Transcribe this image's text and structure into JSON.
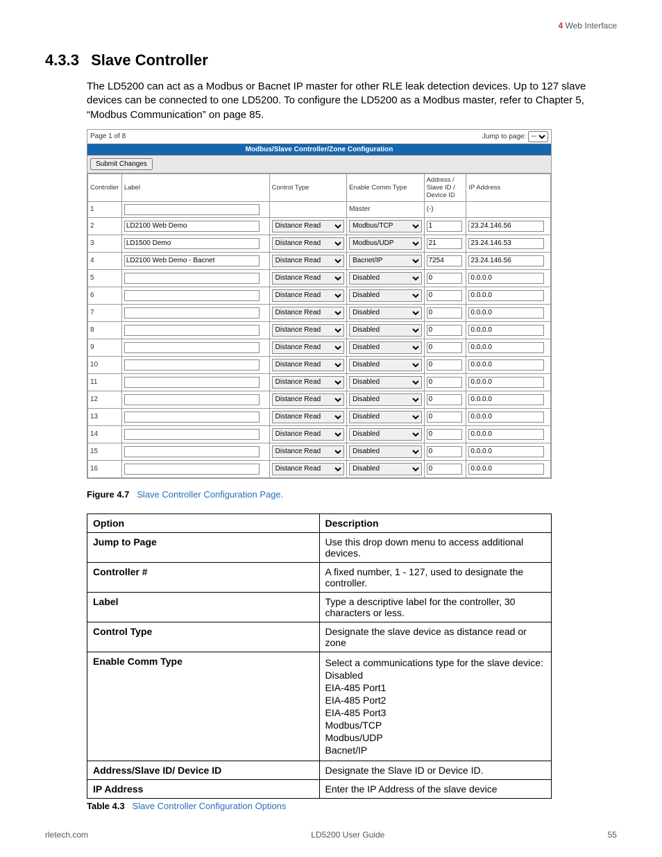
{
  "header": {
    "chapter_num": "4",
    "chapter_title": "Web Interface"
  },
  "section": {
    "number": "4.3.3",
    "title": "Slave Controller"
  },
  "body_paragraph": "The LD5200 can act as a Modbus or Bacnet IP master for other RLE leak detection devices. Up to 127 slave devices can be connected to one LD5200. To configure the LD5200 as a Modbus master, refer to Chapter 5, “Modbus Communication” on page 85.",
  "screenshot": {
    "page_indicator": "Page 1 of 8",
    "jump_label": "Jump to page:",
    "jump_value": "--",
    "title": "Modbus/Slave Controller/Zone Configuration",
    "submit_label": "Submit Changes",
    "columns": {
      "controller": "Controller",
      "label": "Label",
      "control_type": "Control Type",
      "enable_comm": "Enable Comm Type",
      "address": "Address / Slave ID / Device ID",
      "ip": "IP Address"
    },
    "rows": [
      {
        "n": "1",
        "label": "",
        "ctype": "",
        "ctype_select": false,
        "comm": "Master",
        "comm_select": false,
        "addr": "(-)",
        "addr_input": false,
        "ip": "",
        "ip_input": false
      },
      {
        "n": "2",
        "label": "LD2100 Web Demo",
        "ctype": "Distance Read",
        "ctype_select": true,
        "comm": "Modbus/TCP",
        "comm_select": true,
        "addr": "1",
        "addr_input": true,
        "ip": "23.24.146.56",
        "ip_input": true
      },
      {
        "n": "3",
        "label": "LD1500 Demo",
        "ctype": "Distance Read",
        "ctype_select": true,
        "comm": "Modbus/UDP",
        "comm_select": true,
        "addr": "21",
        "addr_input": true,
        "ip": "23.24.146.53",
        "ip_input": true
      },
      {
        "n": "4",
        "label": "LD2100 Web Demo - Bacnet",
        "ctype": "Distance Read",
        "ctype_select": true,
        "comm": "Bacnet/IP",
        "comm_select": true,
        "addr": "7254",
        "addr_input": true,
        "ip": "23.24.146.56",
        "ip_input": true
      },
      {
        "n": "5",
        "label": "",
        "ctype": "Distance Read",
        "ctype_select": true,
        "comm": "Disabled",
        "comm_select": true,
        "addr": "0",
        "addr_input": true,
        "ip": "0.0.0.0",
        "ip_input": true
      },
      {
        "n": "6",
        "label": "",
        "ctype": "Distance Read",
        "ctype_select": true,
        "comm": "Disabled",
        "comm_select": true,
        "addr": "0",
        "addr_input": true,
        "ip": "0.0.0.0",
        "ip_input": true
      },
      {
        "n": "7",
        "label": "",
        "ctype": "Distance Read",
        "ctype_select": true,
        "comm": "Disabled",
        "comm_select": true,
        "addr": "0",
        "addr_input": true,
        "ip": "0.0.0.0",
        "ip_input": true
      },
      {
        "n": "8",
        "label": "",
        "ctype": "Distance Read",
        "ctype_select": true,
        "comm": "Disabled",
        "comm_select": true,
        "addr": "0",
        "addr_input": true,
        "ip": "0.0.0.0",
        "ip_input": true
      },
      {
        "n": "9",
        "label": "",
        "ctype": "Distance Read",
        "ctype_select": true,
        "comm": "Disabled",
        "comm_select": true,
        "addr": "0",
        "addr_input": true,
        "ip": "0.0.0.0",
        "ip_input": true
      },
      {
        "n": "10",
        "label": "",
        "ctype": "Distance Read",
        "ctype_select": true,
        "comm": "Disabled",
        "comm_select": true,
        "addr": "0",
        "addr_input": true,
        "ip": "0.0.0.0",
        "ip_input": true
      },
      {
        "n": "11",
        "label": "",
        "ctype": "Distance Read",
        "ctype_select": true,
        "comm": "Disabled",
        "comm_select": true,
        "addr": "0",
        "addr_input": true,
        "ip": "0.0.0.0",
        "ip_input": true
      },
      {
        "n": "12",
        "label": "",
        "ctype": "Distance Read",
        "ctype_select": true,
        "comm": "Disabled",
        "comm_select": true,
        "addr": "0",
        "addr_input": true,
        "ip": "0.0.0.0",
        "ip_input": true
      },
      {
        "n": "13",
        "label": "",
        "ctype": "Distance Read",
        "ctype_select": true,
        "comm": "Disabled",
        "comm_select": true,
        "addr": "0",
        "addr_input": true,
        "ip": "0.0.0.0",
        "ip_input": true
      },
      {
        "n": "14",
        "label": "",
        "ctype": "Distance Read",
        "ctype_select": true,
        "comm": "Disabled",
        "comm_select": true,
        "addr": "0",
        "addr_input": true,
        "ip": "0.0.0.0",
        "ip_input": true
      },
      {
        "n": "15",
        "label": "",
        "ctype": "Distance Read",
        "ctype_select": true,
        "comm": "Disabled",
        "comm_select": true,
        "addr": "0",
        "addr_input": true,
        "ip": "0.0.0.0",
        "ip_input": true
      },
      {
        "n": "16",
        "label": "",
        "ctype": "Distance Read",
        "ctype_select": true,
        "comm": "Disabled",
        "comm_select": true,
        "addr": "0",
        "addr_input": true,
        "ip": "0.0.0.0",
        "ip_input": true
      }
    ]
  },
  "figure": {
    "label": "Figure 4.7",
    "title": "Slave Controller Configuration Page."
  },
  "options_table": {
    "head": {
      "option": "Option",
      "description": "Description"
    },
    "rows": [
      {
        "option": "Jump to Page",
        "desc": [
          "Use this drop down menu to access additional devices."
        ]
      },
      {
        "option": "Controller #",
        "desc": [
          "A fixed number, 1 - 127, used to designate the controller."
        ]
      },
      {
        "option": "Label",
        "desc": [
          "Type a descriptive label for the controller, 30 characters or less."
        ]
      },
      {
        "option": "Control Type",
        "desc": [
          "Designate the slave device as distance read or zone"
        ]
      },
      {
        "option": "Enable Comm Type",
        "desc": [
          "Select a communications type for the slave device:",
          "Disabled",
          "EIA-485 Port1",
          "EIA-485 Port2",
          "EIA-485 Port3",
          "Modbus/TCP",
          "Modbus/UDP",
          "Bacnet/IP"
        ]
      },
      {
        "option": "Address/Slave ID/ Device ID",
        "desc": [
          "Designate the Slave ID or Device ID."
        ]
      },
      {
        "option": "IP Address",
        "desc": [
          "Enter the IP Address of the slave device"
        ]
      }
    ]
  },
  "table_caption": {
    "label": "Table 4.3",
    "title": "Slave Controller Configuration Options"
  },
  "footer": {
    "left": "rletech.com",
    "center": "LD5200 User Guide",
    "right": "55"
  }
}
